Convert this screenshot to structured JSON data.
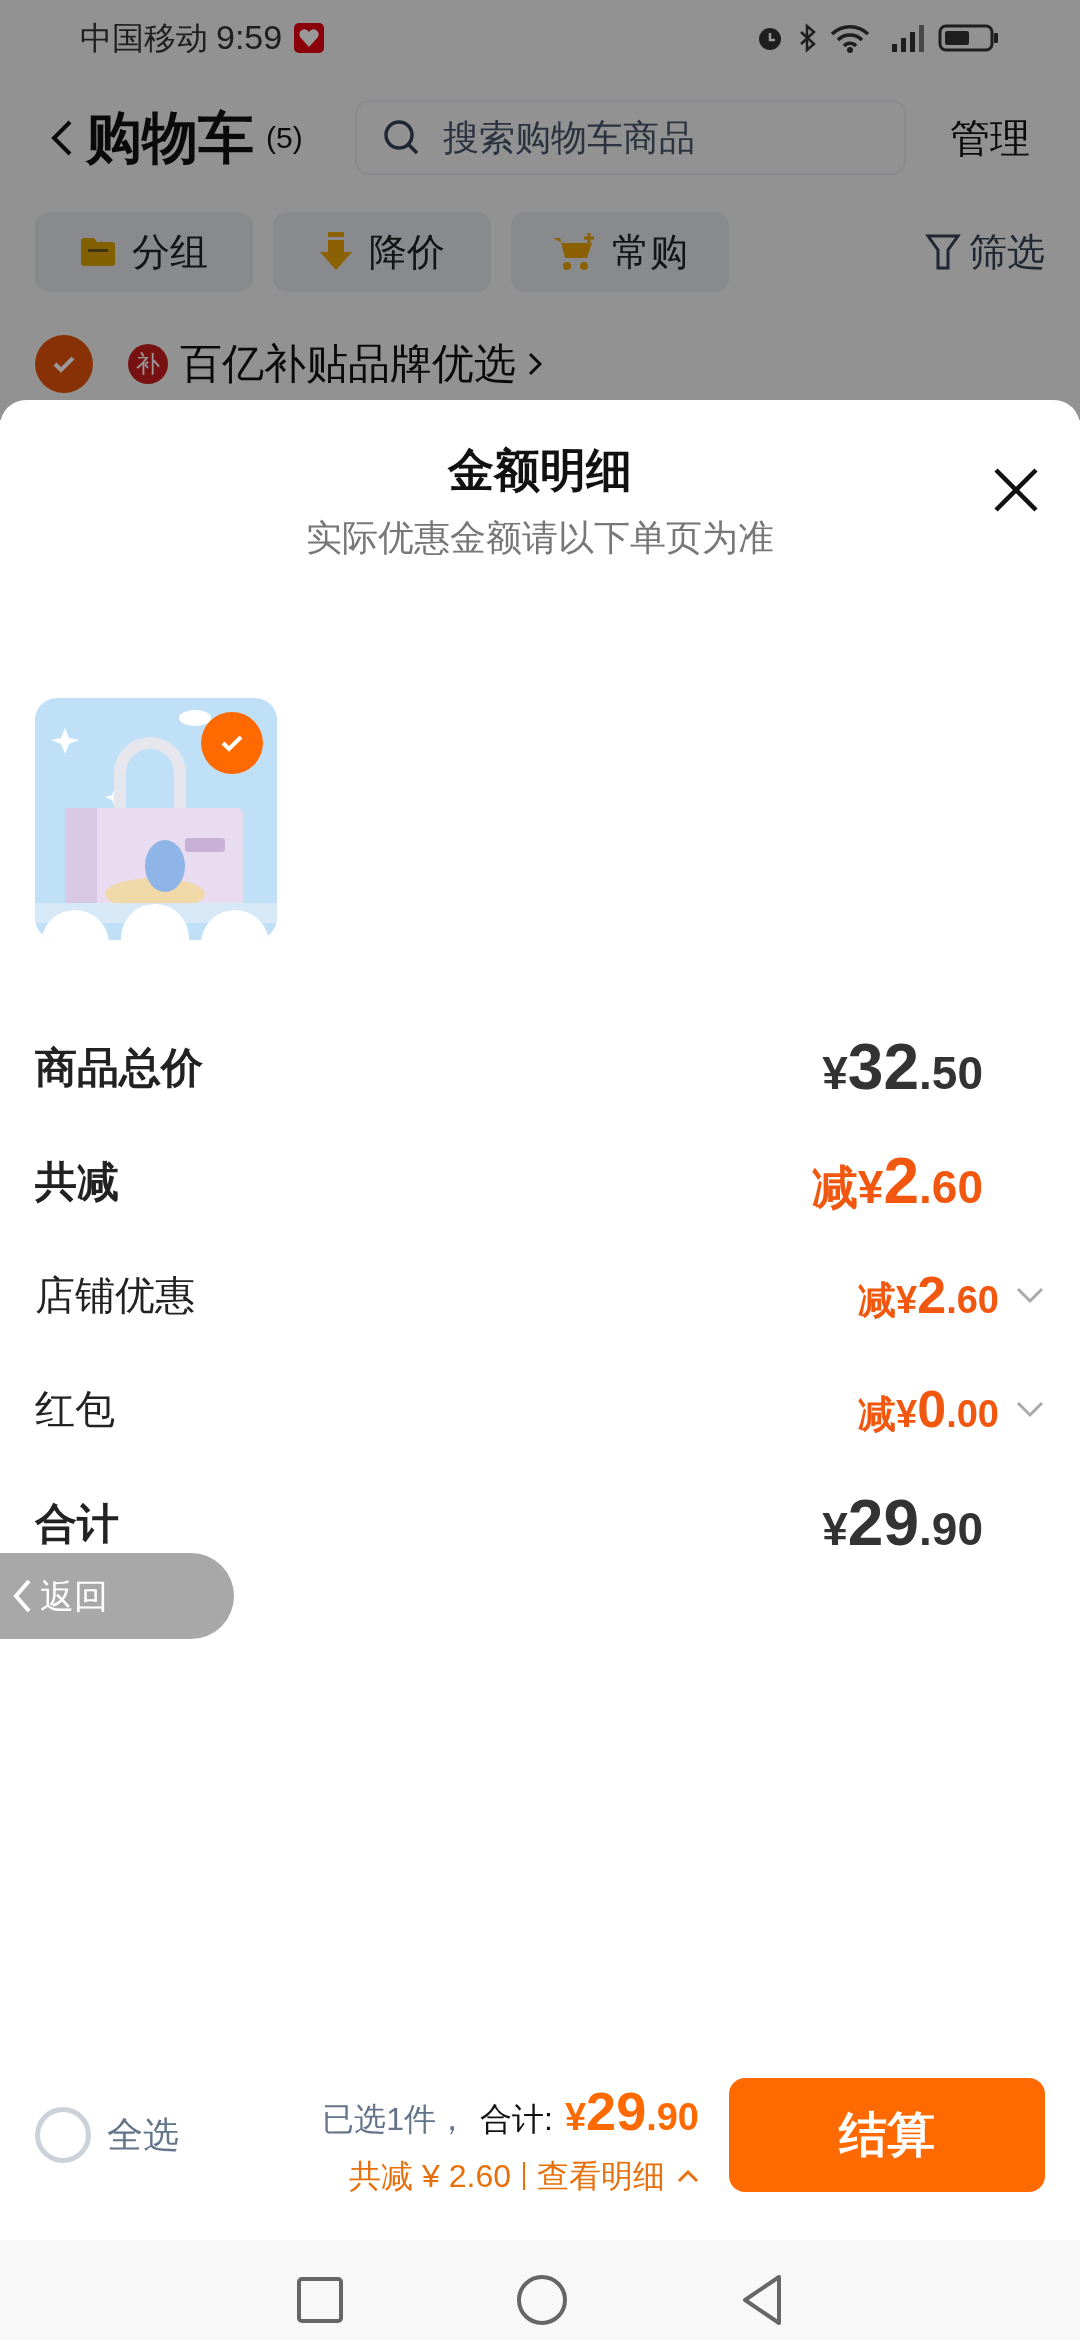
{
  "status_bar": {
    "carrier": "中国移动",
    "time": "9:59"
  },
  "header": {
    "title": "购物车",
    "count": "(5)",
    "search": {
      "placeholder": "搜索购物车商品"
    },
    "manage": "管理"
  },
  "chips": [
    {
      "label": "分组",
      "kind": "folder"
    },
    {
      "label": "降价",
      "kind": "price_drop"
    },
    {
      "label": "常购",
      "kind": "cart"
    }
  ],
  "filter": "筛选",
  "store_group": {
    "checked": true,
    "badge": "补",
    "name": "百亿补贴品牌优选"
  },
  "sheet": {
    "title": "金额明细",
    "subtitle": "实际优惠金额请以下单页为准",
    "items": [
      {
        "kind": "picture",
        "selected": true
      }
    ],
    "rows": [
      {
        "label": "商品总价",
        "amount": "¥32.50",
        "kind": "total"
      },
      {
        "label": "共减",
        "amount": "减¥2.60",
        "kind": "discount_total"
      },
      {
        "label": "店铺优惠",
        "amount": "减¥2.60",
        "kind": "discount_detail"
      },
      {
        "label": "红包",
        "amount": "减¥0.00",
        "kind": "discount_detail"
      },
      {
        "label": "合计",
        "amount": "¥29.90",
        "kind": "total"
      }
    ]
  },
  "back_pill": {
    "label": "返回"
  },
  "bottom_bar": {
    "select_all": {
      "label": "全选",
      "checked": false
    },
    "selected_count": "已选1件，",
    "total_label": "合计:",
    "total": "¥29.90",
    "discount": "共减 ¥ 2.60",
    "detail_link": "查看明细",
    "checkout": "结算"
  }
}
